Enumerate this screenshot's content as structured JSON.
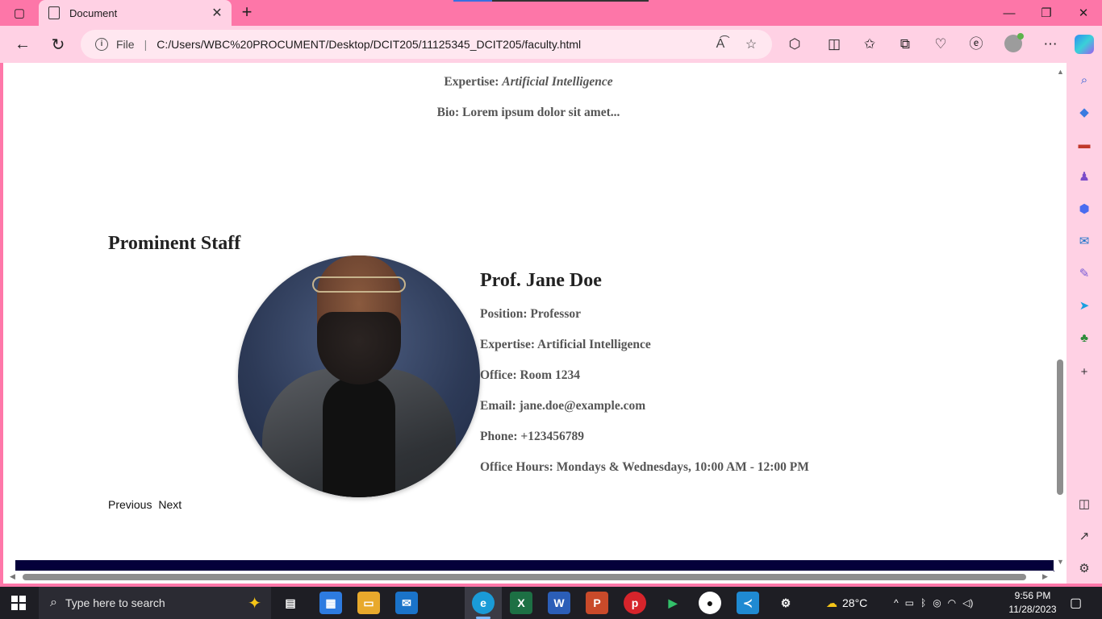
{
  "browser": {
    "tab_title": "Document",
    "url_scheme": "File",
    "url": "C:/Users/WBC%20PROCUMENT/Desktop/DCIT205/11125345_DCIT205/faculty.html"
  },
  "page": {
    "top_expertise_label": "Expertise:",
    "top_expertise_value": "Artificial Intelligence",
    "top_bio": "Bio: Lorem ipsum dolor sit amet...",
    "section_title": "Prominent Staff",
    "staff": {
      "name": "Prof. Jane Doe",
      "position": "Position: Professor",
      "expertise": "Expertise: Artificial Intelligence",
      "office": "Office: Room 1234",
      "email": "Email: jane.doe@example.com",
      "phone": "Phone: +123456789",
      "office_hours": "Office Hours: Mondays & Wednesdays, 10:00 AM - 12:00 PM"
    },
    "pager": {
      "previous": "Previous",
      "next": "Next"
    },
    "colors": {
      "footer_bar": "#04003a",
      "browser_frame": "#fd76a8"
    }
  },
  "taskbar": {
    "search_placeholder": "Type here to search",
    "weather": "28°C",
    "time": "9:56 PM",
    "date": "11/28/2023"
  }
}
